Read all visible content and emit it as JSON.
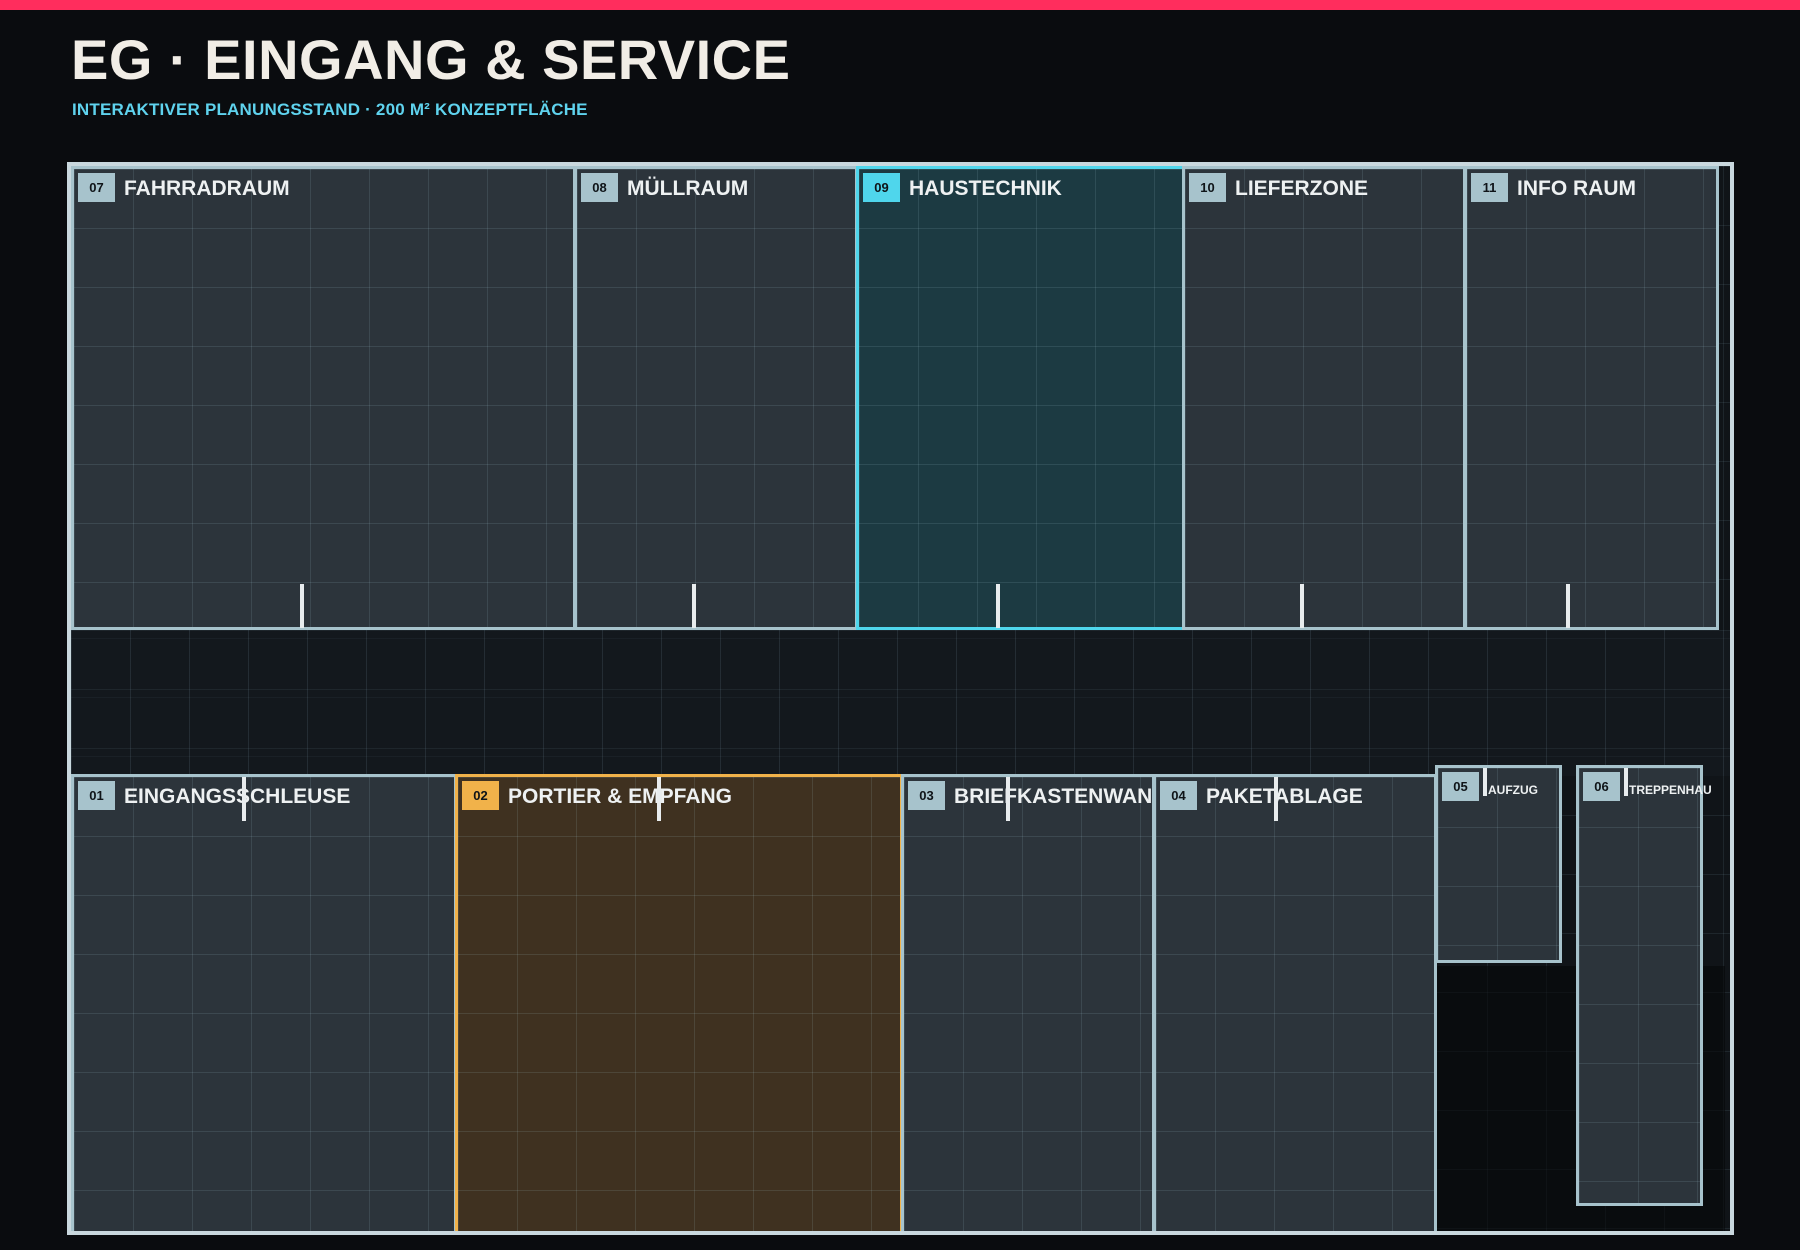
{
  "header": {
    "title": "EG · EINGANG & SERVICE",
    "subtitle": "INTERAKTIVER PLANUNGSSTAND · 200 M² KONZEPTFLÄCHE"
  },
  "colors": {
    "accent_bar": "#ff2d5d",
    "selected_cyan": "#4fd6ec",
    "selected_amber": "#f1b24a",
    "room_border": "#a7c3cc"
  },
  "rooms": {
    "r07": {
      "number": "07",
      "name": "FAHRRADRAUM"
    },
    "r08": {
      "number": "08",
      "name": "MÜLLRAUM"
    },
    "r09": {
      "number": "09",
      "name": "HAUSTECHNIK"
    },
    "r10": {
      "number": "10",
      "name": "LIEFERZONE"
    },
    "r11": {
      "number": "11",
      "name": "INFO RAUM"
    },
    "r01": {
      "number": "01",
      "name": "EINGANGSSCHLEUSE"
    },
    "r02": {
      "number": "02",
      "name": "PORTIER & EMPFANG"
    },
    "r03": {
      "number": "03",
      "name": "BRIEFKASTENWAND"
    },
    "r04": {
      "number": "04",
      "name": "PAKETABLAGE"
    },
    "r05": {
      "number": "05",
      "name": "AUFZUG"
    },
    "r06": {
      "number": "06",
      "name": "TREPPENHAU"
    }
  }
}
